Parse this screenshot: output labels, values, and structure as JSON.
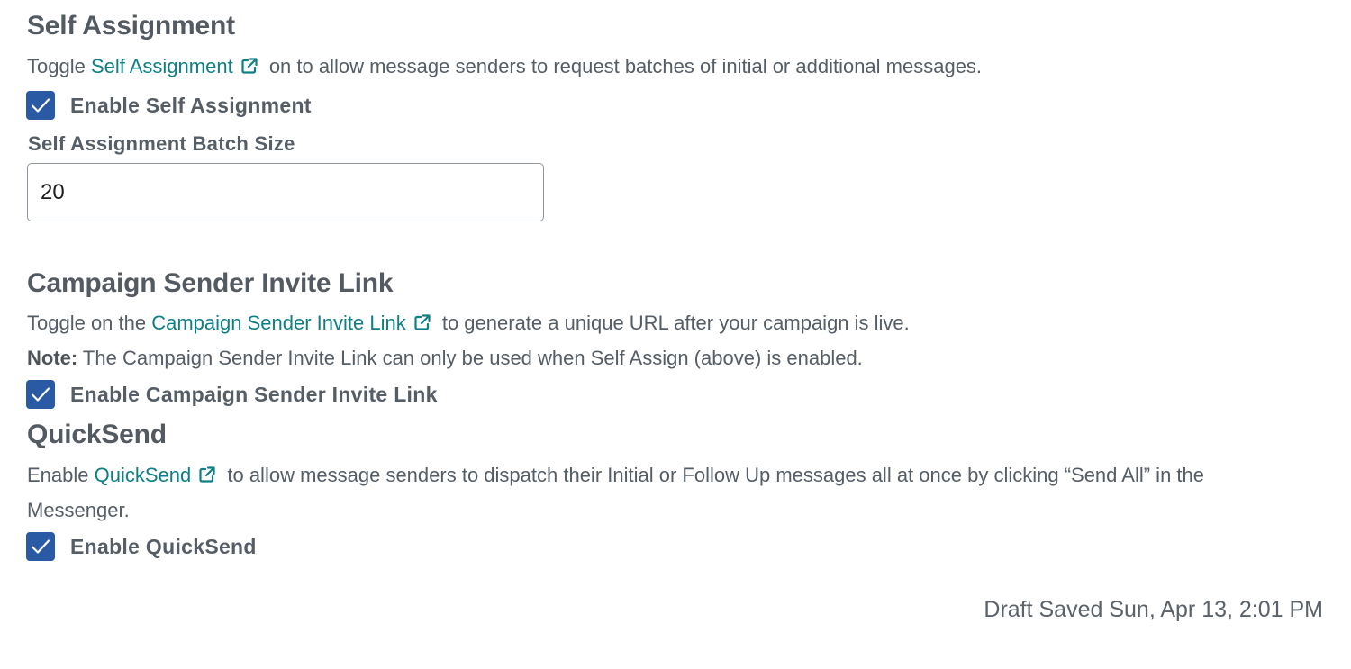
{
  "self_assignment": {
    "title": "Self Assignment",
    "desc_before": "Toggle ",
    "desc_link": "Self Assignment",
    "desc_after": " on to allow message senders to request batches of initial or additional messages.",
    "checkbox_label": "Enable Self Assignment",
    "checked": true,
    "batch_size_label": "Self Assignment Batch Size",
    "batch_size_value": "20"
  },
  "invite_link": {
    "title": "Campaign Sender Invite Link",
    "desc_before": "Toggle on the ",
    "desc_link": "Campaign Sender Invite Link",
    "desc_after": " to generate a unique URL after your campaign is live.",
    "note_label": "Note:",
    "note_text": " The Campaign Sender Invite Link can only be used when Self Assign (above) is enabled.",
    "checkbox_label": "Enable Campaign Sender Invite Link",
    "checked": true
  },
  "quicksend": {
    "title": "QuickSend",
    "desc_before": "Enable ",
    "desc_link": "QuickSend",
    "desc_after": " to allow message senders to dispatch their Initial or Follow Up messages all at once by clicking “Send All” in the",
    "desc_line2": "Messenger.",
    "checkbox_label": "Enable QuickSend",
    "checked": true
  },
  "status": {
    "draft_saved": "Draft Saved Sun, Apr 13, 2:01 PM"
  },
  "icons": {
    "external_link": "external-link-icon",
    "checkmark": "checkmark-icon"
  },
  "colors": {
    "link": "#0f7f86",
    "checkbox": "#2a5aa3",
    "text": "#535a62"
  }
}
